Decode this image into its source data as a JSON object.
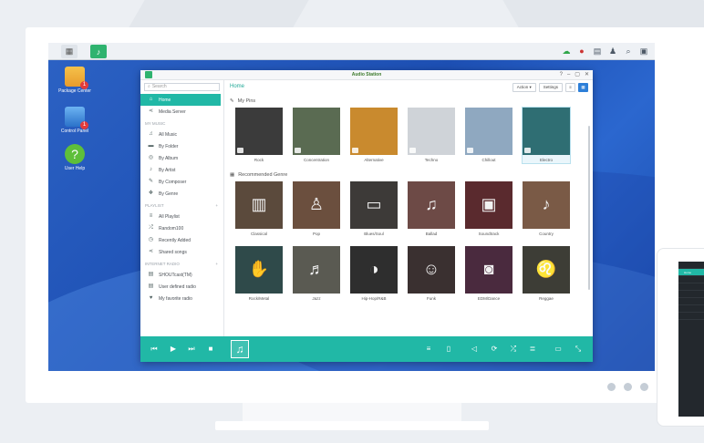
{
  "window": {
    "title": "Audio Station",
    "controls": [
      "?",
      "–",
      "▢",
      "✕"
    ]
  },
  "desktop": {
    "icons": [
      {
        "label": "Package Center",
        "badge": "1"
      },
      {
        "label": "Control Panel",
        "badge": "1"
      },
      {
        "label": "User Help"
      }
    ]
  },
  "sidebar": {
    "search_placeholder": "Search",
    "items_top": [
      {
        "label": "Home",
        "icon": "home-icon"
      },
      {
        "label": "Media Server",
        "icon": "share-icon"
      }
    ],
    "my_music_header": "MY MUSIC",
    "my_music": [
      {
        "label": "All Music",
        "icon": "note-icon"
      },
      {
        "label": "By Folder",
        "icon": "folder-icon"
      },
      {
        "label": "By Album",
        "icon": "disc-icon"
      },
      {
        "label": "By Artist",
        "icon": "mic-icon"
      },
      {
        "label": "By Composer",
        "icon": "pen-icon"
      },
      {
        "label": "By Genre",
        "icon": "genre-icon"
      }
    ],
    "playlist_header": "PLAYLIST",
    "playlist": [
      {
        "label": "All Playlist",
        "icon": "playlist-icon"
      },
      {
        "label": "Random100",
        "icon": "shuffle-icon"
      },
      {
        "label": "Recently Added",
        "icon": "clock-icon"
      },
      {
        "label": "Shared songs",
        "icon": "share-icon"
      }
    ],
    "radio_header": "INTERNET RADIO",
    "radio": [
      {
        "label": "SHOUTcast(TM)",
        "icon": "radio-icon"
      },
      {
        "label": "User defined radio",
        "icon": "radio-icon"
      },
      {
        "label": "My favorite radio",
        "icon": "heart-icon"
      }
    ]
  },
  "main": {
    "breadcrumb": "Home",
    "action_label": "Action",
    "settings_label": "Settings",
    "my_pins_label": "My Pins",
    "recommended_label": "Recommended Genre",
    "pins": [
      {
        "label": "Rock",
        "color": "#3b3b3b"
      },
      {
        "label": "Concentration",
        "color": "#5a6b52"
      },
      {
        "label": "Alternative",
        "color": "#c98a2e"
      },
      {
        "label": "Techno",
        "color": "#cfd3d8"
      },
      {
        "label": "Chillout",
        "color": "#8fa8c0"
      },
      {
        "label": "Electro",
        "color": "#2f6e73"
      }
    ],
    "genres_row1": [
      {
        "label": "Classical",
        "color": "#5b4a3c",
        "icon": "piano-icon",
        "glyph": "▥"
      },
      {
        "label": "Pop",
        "color": "#6b4f3e",
        "icon": "microphone-icon",
        "glyph": "♙"
      },
      {
        "label": "Blues/Soul",
        "color": "#3d3a38",
        "icon": "cassette-icon",
        "glyph": "▭"
      },
      {
        "label": "Ballad",
        "color": "#6d4a46",
        "icon": "music-note-icon",
        "glyph": "♫"
      },
      {
        "label": "Soundtrack",
        "color": "#5a2a2e",
        "icon": "speaker-icon",
        "glyph": "▣"
      },
      {
        "label": "Country",
        "color": "#7a5a46",
        "icon": "guitar-icon",
        "glyph": "♪"
      }
    ],
    "genres_row2": [
      {
        "label": "Rock/Metal",
        "color": "#2f4a4a",
        "icon": "rock-hand-icon",
        "glyph": "✋"
      },
      {
        "label": "Jazz",
        "color": "#5a5a52",
        "icon": "saxophone-icon",
        "glyph": "♬"
      },
      {
        "label": "Hip-Hop/R&B",
        "color": "#2e2e2e",
        "icon": "sunglasses-icon",
        "glyph": "◑"
      },
      {
        "label": "Funk",
        "color": "#3a3030",
        "icon": "afro-icon",
        "glyph": "☺"
      },
      {
        "label": "EDM/Dance",
        "color": "#4a2a3e",
        "icon": "boombox-icon",
        "glyph": "◙"
      },
      {
        "label": "Reggae",
        "color": "#3d3d36",
        "icon": "lion-icon",
        "glyph": "♌"
      }
    ]
  },
  "phone": {
    "rows": [
      "",
      "Home",
      "",
      "",
      "",
      "",
      "",
      ""
    ]
  }
}
